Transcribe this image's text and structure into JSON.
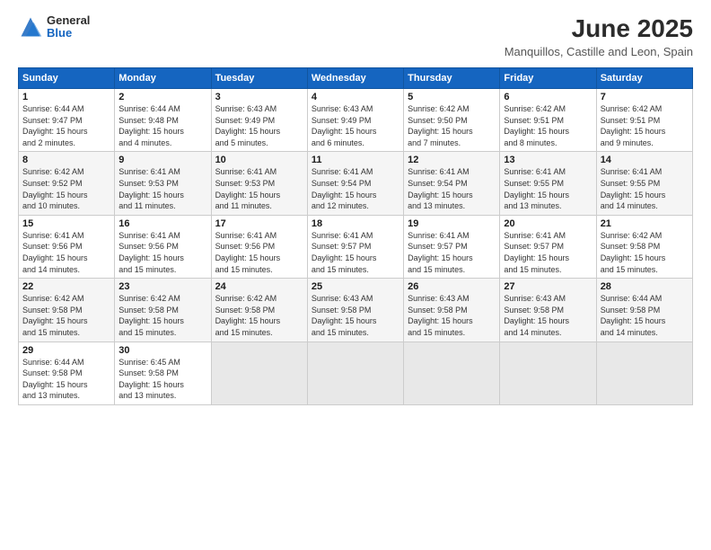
{
  "logo": {
    "general": "General",
    "blue": "Blue"
  },
  "title": "June 2025",
  "subtitle": "Manquillos, Castille and Leon, Spain",
  "headers": [
    "Sunday",
    "Monday",
    "Tuesday",
    "Wednesday",
    "Thursday",
    "Friday",
    "Saturday"
  ],
  "weeks": [
    [
      {
        "day": "1",
        "detail": "Sunrise: 6:44 AM\nSunset: 9:47 PM\nDaylight: 15 hours\nand 2 minutes."
      },
      {
        "day": "2",
        "detail": "Sunrise: 6:44 AM\nSunset: 9:48 PM\nDaylight: 15 hours\nand 4 minutes."
      },
      {
        "day": "3",
        "detail": "Sunrise: 6:43 AM\nSunset: 9:49 PM\nDaylight: 15 hours\nand 5 minutes."
      },
      {
        "day": "4",
        "detail": "Sunrise: 6:43 AM\nSunset: 9:49 PM\nDaylight: 15 hours\nand 6 minutes."
      },
      {
        "day": "5",
        "detail": "Sunrise: 6:42 AM\nSunset: 9:50 PM\nDaylight: 15 hours\nand 7 minutes."
      },
      {
        "day": "6",
        "detail": "Sunrise: 6:42 AM\nSunset: 9:51 PM\nDaylight: 15 hours\nand 8 minutes."
      },
      {
        "day": "7",
        "detail": "Sunrise: 6:42 AM\nSunset: 9:51 PM\nDaylight: 15 hours\nand 9 minutes."
      }
    ],
    [
      {
        "day": "8",
        "detail": "Sunrise: 6:42 AM\nSunset: 9:52 PM\nDaylight: 15 hours\nand 10 minutes."
      },
      {
        "day": "9",
        "detail": "Sunrise: 6:41 AM\nSunset: 9:53 PM\nDaylight: 15 hours\nand 11 minutes."
      },
      {
        "day": "10",
        "detail": "Sunrise: 6:41 AM\nSunset: 9:53 PM\nDaylight: 15 hours\nand 11 minutes."
      },
      {
        "day": "11",
        "detail": "Sunrise: 6:41 AM\nSunset: 9:54 PM\nDaylight: 15 hours\nand 12 minutes."
      },
      {
        "day": "12",
        "detail": "Sunrise: 6:41 AM\nSunset: 9:54 PM\nDaylight: 15 hours\nand 13 minutes."
      },
      {
        "day": "13",
        "detail": "Sunrise: 6:41 AM\nSunset: 9:55 PM\nDaylight: 15 hours\nand 13 minutes."
      },
      {
        "day": "14",
        "detail": "Sunrise: 6:41 AM\nSunset: 9:55 PM\nDaylight: 15 hours\nand 14 minutes."
      }
    ],
    [
      {
        "day": "15",
        "detail": "Sunrise: 6:41 AM\nSunset: 9:56 PM\nDaylight: 15 hours\nand 14 minutes."
      },
      {
        "day": "16",
        "detail": "Sunrise: 6:41 AM\nSunset: 9:56 PM\nDaylight: 15 hours\nand 15 minutes."
      },
      {
        "day": "17",
        "detail": "Sunrise: 6:41 AM\nSunset: 9:56 PM\nDaylight: 15 hours\nand 15 minutes."
      },
      {
        "day": "18",
        "detail": "Sunrise: 6:41 AM\nSunset: 9:57 PM\nDaylight: 15 hours\nand 15 minutes."
      },
      {
        "day": "19",
        "detail": "Sunrise: 6:41 AM\nSunset: 9:57 PM\nDaylight: 15 hours\nand 15 minutes."
      },
      {
        "day": "20",
        "detail": "Sunrise: 6:41 AM\nSunset: 9:57 PM\nDaylight: 15 hours\nand 15 minutes."
      },
      {
        "day": "21",
        "detail": "Sunrise: 6:42 AM\nSunset: 9:58 PM\nDaylight: 15 hours\nand 15 minutes."
      }
    ],
    [
      {
        "day": "22",
        "detail": "Sunrise: 6:42 AM\nSunset: 9:58 PM\nDaylight: 15 hours\nand 15 minutes."
      },
      {
        "day": "23",
        "detail": "Sunrise: 6:42 AM\nSunset: 9:58 PM\nDaylight: 15 hours\nand 15 minutes."
      },
      {
        "day": "24",
        "detail": "Sunrise: 6:42 AM\nSunset: 9:58 PM\nDaylight: 15 hours\nand 15 minutes."
      },
      {
        "day": "25",
        "detail": "Sunrise: 6:43 AM\nSunset: 9:58 PM\nDaylight: 15 hours\nand 15 minutes."
      },
      {
        "day": "26",
        "detail": "Sunrise: 6:43 AM\nSunset: 9:58 PM\nDaylight: 15 hours\nand 15 minutes."
      },
      {
        "day": "27",
        "detail": "Sunrise: 6:43 AM\nSunset: 9:58 PM\nDaylight: 15 hours\nand 14 minutes."
      },
      {
        "day": "28",
        "detail": "Sunrise: 6:44 AM\nSunset: 9:58 PM\nDaylight: 15 hours\nand 14 minutes."
      }
    ],
    [
      {
        "day": "29",
        "detail": "Sunrise: 6:44 AM\nSunset: 9:58 PM\nDaylight: 15 hours\nand 13 minutes."
      },
      {
        "day": "30",
        "detail": "Sunrise: 6:45 AM\nSunset: 9:58 PM\nDaylight: 15 hours\nand 13 minutes."
      },
      {
        "day": "",
        "detail": ""
      },
      {
        "day": "",
        "detail": ""
      },
      {
        "day": "",
        "detail": ""
      },
      {
        "day": "",
        "detail": ""
      },
      {
        "day": "",
        "detail": ""
      }
    ]
  ]
}
